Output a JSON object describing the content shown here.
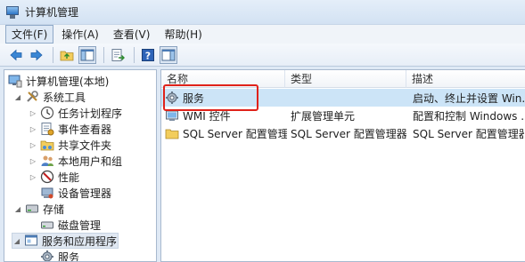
{
  "window": {
    "title": "计算机管理"
  },
  "menu": [
    {
      "label": "文件(F)"
    },
    {
      "label": "操作(A)"
    },
    {
      "label": "查看(V)"
    },
    {
      "label": "帮助(H)"
    }
  ],
  "tree": {
    "root": "计算机管理(本地)",
    "system_tools": "系统工具",
    "task_scheduler": "任务计划程序",
    "event_viewer": "事件查看器",
    "shared_folders": "共享文件夹",
    "local_users": "本地用户和组",
    "performance": "性能",
    "device_manager": "设备管理器",
    "storage": "存储",
    "disk_management": "磁盘管理",
    "services_apps": "服务和应用程序",
    "services": "服务"
  },
  "list": {
    "columns": {
      "name": "名称",
      "type": "类型",
      "desc": "描述"
    },
    "rows": [
      {
        "name": "服务",
        "type": "",
        "desc": "启动、终止并设置 Win..."
      },
      {
        "name": "WMI 控件",
        "type": "扩展管理单元",
        "desc": "配置和控制 Windows ..."
      },
      {
        "name": "SQL Server 配置管理...",
        "type": "SQL Server 配置管理器",
        "desc": "SQL Server 配置管理器"
      }
    ]
  },
  "colors": {
    "selection": "#cce4f7",
    "highlight": "#e0221a",
    "accent": "#2f77c8"
  }
}
